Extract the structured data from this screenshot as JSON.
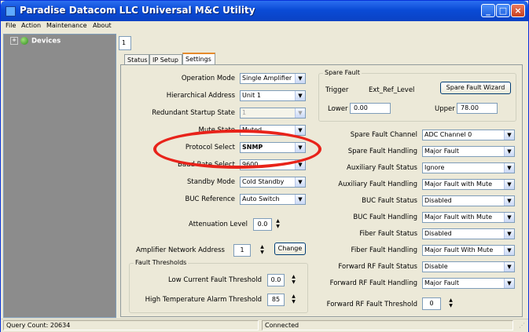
{
  "window": {
    "title": "Paradise Datacom LLC Universal M&C Utility"
  },
  "menu": [
    "File",
    "Action",
    "Maintenance",
    "About"
  ],
  "tree": {
    "root_label": "Devices"
  },
  "unit_tab": "1",
  "tabs": [
    "Status",
    "IP Setup",
    "Settings"
  ],
  "left": {
    "operation_mode": {
      "label": "Operation Mode",
      "value": "Single Amplifier"
    },
    "hierarchical_address": {
      "label": "Hierarchical Address",
      "value": "Unit 1"
    },
    "redundant_startup_state": {
      "label": "Redundant Startup State",
      "value": "1"
    },
    "mute_state": {
      "label": "Mute State",
      "value": "Muted"
    },
    "protocol_select": {
      "label": "Protocol Select",
      "value": "SNMP"
    },
    "baud_rate_select": {
      "label": "Baud Rate Select",
      "value": "9600"
    },
    "standby_mode": {
      "label": "Standby Mode",
      "value": "Cold Standby"
    },
    "buc_reference": {
      "label": "BUC Reference",
      "value": "Auto Switch"
    },
    "attenuation_level": {
      "label": "Attenuation Level",
      "value": "0.0"
    },
    "amplifier_network_address": {
      "label": "Amplifier Network Address",
      "value": "1",
      "button": "Change"
    },
    "fault_thresholds": {
      "title": "Fault Thresholds",
      "low_current": {
        "label": "Low Current Fault Threshold",
        "value": "0.0"
      },
      "high_temp": {
        "label": "High Temperature Alarm Threshold",
        "value": "85"
      }
    }
  },
  "spare_fault": {
    "title": "Spare Fault",
    "trigger_label": "Trigger",
    "trigger_value": "Ext_Ref_Level",
    "wizard_button": "Spare Fault Wizard",
    "lower_label": "Lower",
    "lower_value": "0.00",
    "upper_label": "Upper",
    "upper_value": "78.00"
  },
  "right": [
    {
      "label": "Spare Fault Channel",
      "value": "ADC Channel 0"
    },
    {
      "label": "Spare Fault Handling",
      "value": "Major Fault"
    },
    {
      "label": "Auxiliary Fault Status",
      "value": "Ignore"
    },
    {
      "label": "Auxiliary Fault Handling",
      "value": "Major Fault with Mute"
    },
    {
      "label": "BUC Fault Status",
      "value": "Disabled"
    },
    {
      "label": "BUC Fault Handling",
      "value": "Major Fault with Mute"
    },
    {
      "label": "Fiber Fault Status",
      "value": "Disabled"
    },
    {
      "label": "Fiber Fault Handling",
      "value": "Major Fault With Mute"
    },
    {
      "label": "Forward RF Fault Status",
      "value": "Disable"
    },
    {
      "label": "Forward RF Fault Handling",
      "value": "Major Fault"
    }
  ],
  "forward_rf_threshold": {
    "label": "Forward RF Fault Threshold",
    "value": "0"
  },
  "status_bar": {
    "query_count": "Query Count: 20634",
    "connection": "Connected"
  },
  "colors": {
    "highlight_ellipse": "#e8231a",
    "titlebar": "#0a4bd6",
    "tree_bg": "#8c8c8c"
  }
}
